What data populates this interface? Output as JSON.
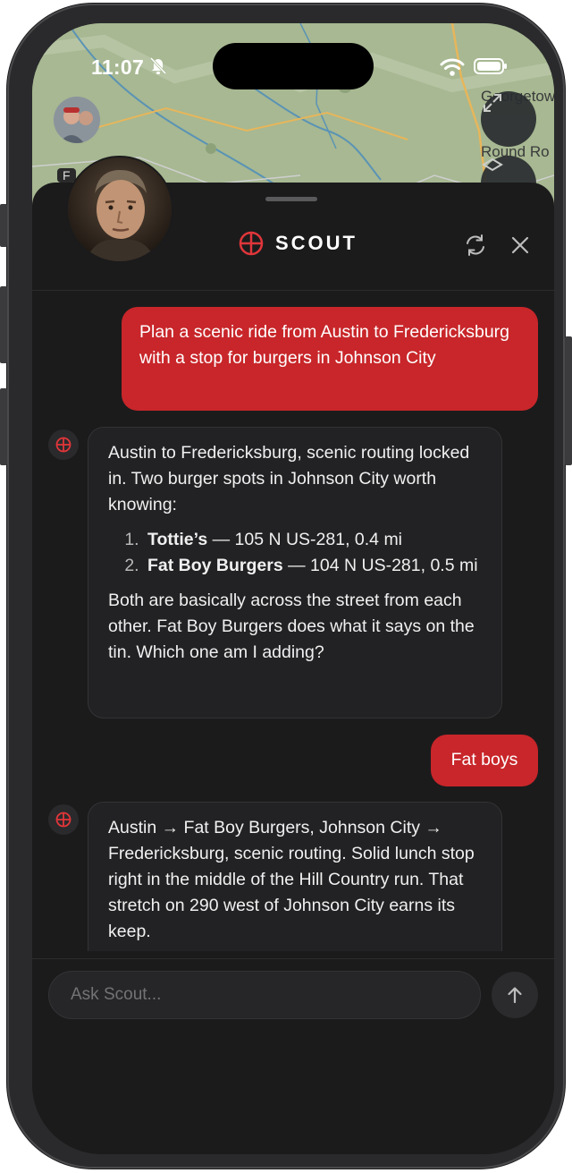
{
  "status_bar": {
    "time": "11:07"
  },
  "map": {
    "labels": [
      "Georgetow",
      "Round Ro",
      "F"
    ]
  },
  "header": {
    "title": "SCOUT"
  },
  "messages": {
    "user_1": "Plan a scenic ride from Austin to Fredericksburg with a stop for burgers in Johnson City",
    "bot_1": {
      "intro": "Austin to Fredericksburg, scenic routing locked in. Two burger spots in Johnson City worth knowing:",
      "items": [
        {
          "name": "Tottie’s",
          "detail": " — 105 N US-281, 0.4 mi"
        },
        {
          "name": "Fat Boy Burgers",
          "detail": " — 104 N US-281, 0.5 mi"
        }
      ],
      "outro": "Both are basically across the street from each other. Fat Boy Burgers does what it says on the tin. Which one am I adding?"
    },
    "user_2": "Fat boys",
    "bot_2": "Austin → Fat Boy Burgers, Johnson City → Fredericksburg, scenic routing. Solid lunch stop right in the middle of the Hill Country run. That stretch on 290 west of Johnson City earns its keep."
  },
  "composer": {
    "placeholder": "Ask Scout..."
  },
  "colors": {
    "accent": "#c8262a",
    "sheet_bg": "#1b1b1c",
    "bubble_bot": "#222224"
  }
}
